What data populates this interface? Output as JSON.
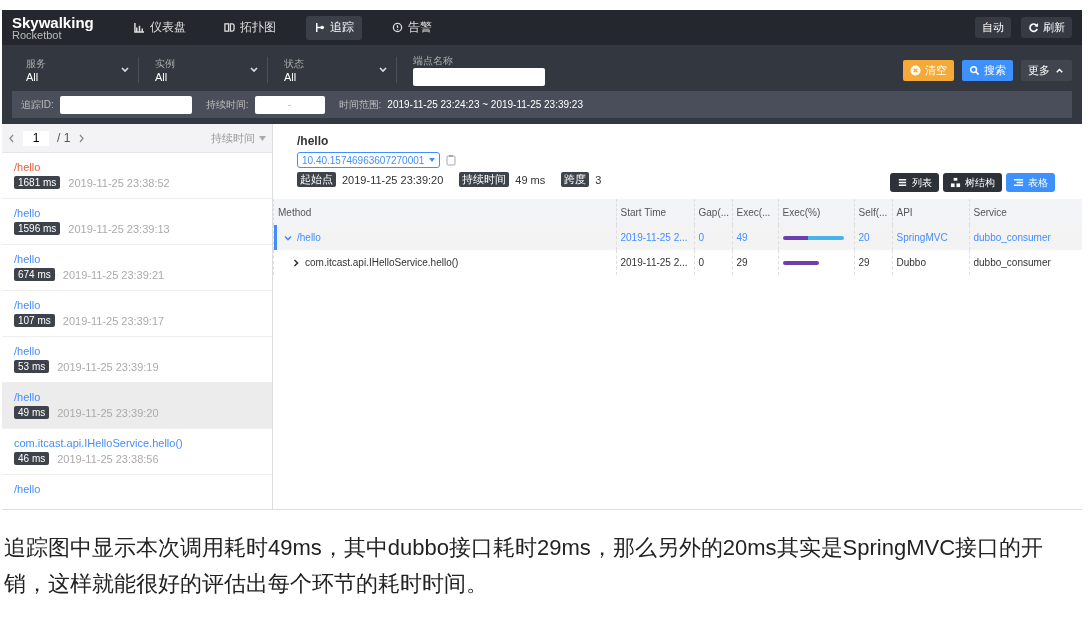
{
  "app": {
    "logo": {
      "name": "Skywalking",
      "sub": "Rocketbot"
    },
    "nav": [
      {
        "label": "仪表盘",
        "selected": false
      },
      {
        "label": "拓扑图",
        "selected": false
      },
      {
        "label": "追踪",
        "selected": true
      },
      {
        "label": "告警",
        "selected": false
      }
    ],
    "header_buttons": [
      "自动",
      "刷新"
    ],
    "filters": [
      {
        "label": "服务",
        "value": "All"
      },
      {
        "label": "实例",
        "value": "All"
      },
      {
        "label": "状态",
        "value": "All"
      }
    ],
    "endpoint_field": {
      "label": "端点名称"
    },
    "actions": [
      {
        "label": "清空",
        "kind": "clear"
      },
      {
        "label": "搜索",
        "kind": "search"
      },
      {
        "label": "更多",
        "kind": "more"
      }
    ],
    "trace_id_field": {
      "label": "追踪ID:"
    },
    "duration_field": {
      "label": "持续时间:",
      "placeholder": "-"
    },
    "time_range": {
      "label": "时间范围:",
      "value": "2019-11-25 23:24:23 ~ 2019-11-25 23:39:23"
    },
    "pager": {
      "page": "1",
      "total": "/ 1",
      "sort": "持续时间"
    },
    "traces": [
      {
        "name": "/hello",
        "error": true,
        "selected": false,
        "duration": "1681 ms",
        "time": "2019-11-25 23:38:52"
      },
      {
        "name": "/hello",
        "error": false,
        "selected": false,
        "duration": "1596 ms",
        "time": "2019-11-25 23:39:13"
      },
      {
        "name": "/hello",
        "error": false,
        "selected": false,
        "duration": "674 ms",
        "time": "2019-11-25 23:39:21"
      },
      {
        "name": "/hello",
        "error": false,
        "selected": false,
        "duration": "107 ms",
        "time": "2019-11-25 23:39:17"
      },
      {
        "name": "/hello",
        "error": false,
        "selected": false,
        "duration": "53 ms",
        "time": "2019-11-25 23:39:19"
      },
      {
        "name": "/hello",
        "error": false,
        "selected": true,
        "duration": "49 ms",
        "time": "2019-11-25 23:39:20"
      },
      {
        "name": "com.itcast.api.IHelloService.hello()",
        "error": false,
        "selected": false,
        "duration": "46 ms",
        "time": "2019-11-25 23:38:56"
      },
      {
        "name": "/hello",
        "error": false,
        "selected": false
      }
    ],
    "detail": {
      "title": "/hello",
      "trace_select": "10.40.15746963607270001",
      "tags": [
        {
          "label": "起始点",
          "value": "2019-11-25 23:39:20"
        },
        {
          "label": "持续时间",
          "value": "49 ms"
        },
        {
          "label": "跨度",
          "value": "3"
        }
      ],
      "views": [
        {
          "label": "列表",
          "selected": false
        },
        {
          "label": "树结构",
          "selected": false
        },
        {
          "label": "表格",
          "selected": true
        }
      ]
    },
    "table": {
      "columns": [
        "Method",
        "Start Time",
        "Gap(...",
        "Exec(...",
        "Exec(%)",
        "Self(...",
        "API",
        "Service"
      ],
      "rows": [
        {
          "method": "/hello",
          "expanded": true,
          "selected": true,
          "start": "2019-11-25 2...",
          "gap": "0",
          "exec": "49",
          "exec_bar": [
            {
              "kind": "self",
              "level": 0.41
            },
            {
              "kind": "children",
              "level": 0.59
            }
          ],
          "self": "20",
          "api": "SpringMVC",
          "service": "dubbo_consumer"
        },
        {
          "method": "com.itcast.api.IHelloService.hello()",
          "expanded": false,
          "selected": false,
          "start": "2019-11-25 2...",
          "gap": "0",
          "exec": "29",
          "exec_bar": [
            {
              "kind": "self",
              "level": 0.59
            }
          ],
          "self": "29",
          "api": "Dubbo",
          "service": "dubbo_consumer"
        }
      ]
    }
  },
  "article": {
    "paragraph": "追踪图中显示本次调用耗时49ms，其中dubbo接口耗时29ms，那么另外的20ms其实是SpringMVC接口的开销，这样就能很好的评估出每个环节的耗时时间。"
  }
}
